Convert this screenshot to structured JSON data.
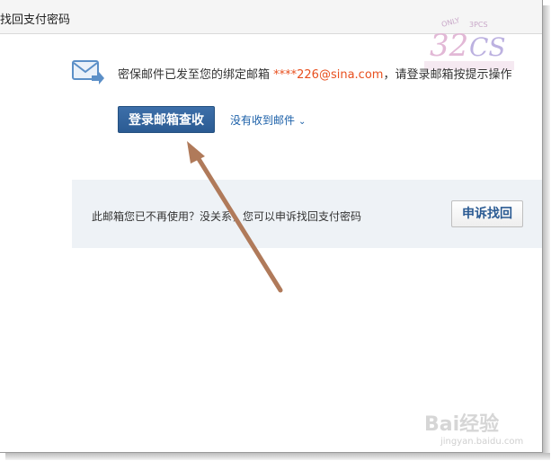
{
  "title": "找回支付密码",
  "notice": {
    "prefix": "密保邮件已发至您的绑定邮箱 ",
    "email": "****226@sina.com",
    "suffix": "，请登录邮箱按提示操作"
  },
  "buttons": {
    "login_mailbox": "登录邮箱查收",
    "appeal": "申诉找回"
  },
  "links": {
    "not_received": "没有收到邮件"
  },
  "panel": {
    "text": "此邮箱您已不再使用？没关系，您可以申诉找回支付密码"
  },
  "watermarks": {
    "top_logo_text": "3PCS",
    "top_logo_small": "ONLY",
    "baidu": "Bai经验",
    "baidu_sub": "jingyan.baidu.com"
  },
  "colors": {
    "email": "#e8501f",
    "primary_button": "#2b5b93",
    "link": "#1a5fa8",
    "arrow": "#b07a5a",
    "panel_bg": "#eef2f6"
  },
  "icons": {
    "mail": "mail-forward-icon",
    "chevron": "chevron-down-icon",
    "annotation": "arrow-annotation"
  }
}
